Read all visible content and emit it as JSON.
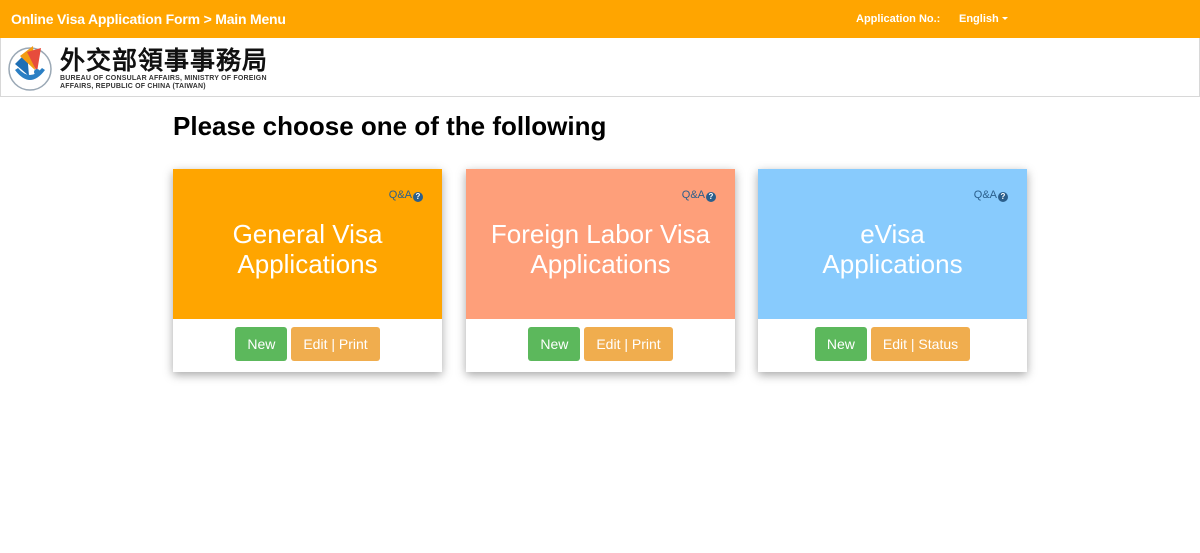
{
  "topbar": {
    "breadcrumb": "Online Visa Application Form > Main Menu",
    "application_no_label": "Application No.:",
    "language": "English"
  },
  "header": {
    "logo_cn": "外交部領事事務局",
    "logo_en_line1": "BUREAU OF CONSULAR AFFAIRS, MINISTRY OF FOREIGN",
    "logo_en_line2": "AFFAIRS, REPUBLIC OF CHINA (TAIWAN)"
  },
  "main": {
    "heading": "Please choose one of the following",
    "qa_label": "Q&A",
    "qa_icon": "?",
    "cards": [
      {
        "title_line1": "General Visa",
        "title_line2": "Applications",
        "new_label": "New",
        "edit_label": "Edit | Print",
        "color": "#ffa500"
      },
      {
        "title_line1": "Foreign Labor Visa",
        "title_line2": "Applications",
        "new_label": "New",
        "edit_label": "Edit | Print",
        "color": "#fe9f7a"
      },
      {
        "title_line1": "eVisa",
        "title_line2": "Applications",
        "new_label": "New",
        "edit_label": "Edit | Status",
        "color": "#88cbfd"
      }
    ]
  },
  "colors": {
    "topbar": "#ffa500",
    "new_button": "#5cb85c",
    "edit_button": "#f0ad4e"
  }
}
